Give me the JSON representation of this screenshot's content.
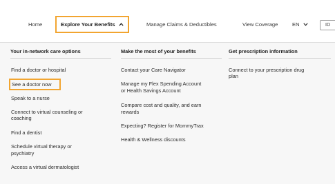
{
  "nav": {
    "home": "Home",
    "explore": "Explore Your Benefits",
    "explore_caret": "^",
    "claims": "Manage Claims & Deductibles",
    "coverage": "View Coverage",
    "lang": "EN",
    "lang_caret": "v",
    "id": "ID"
  },
  "columns": [
    {
      "heading": "Your in-network care options",
      "links": [
        "Find a doctor or hospital",
        "See a doctor now",
        "Speak to a nurse",
        "Connect to virtual counseling or",
        "coaching",
        "Find a dentist",
        "Schedule virtual therapy or",
        "psychiatry",
        "Access a virtual dermatologist"
      ]
    },
    {
      "heading": "Make the most of your benefits",
      "links": [
        "Contact your Care Navigator",
        "Manage my Flex Spending Account",
        "or Health Savings Account",
        "Compare cost and quality, and earn",
        "rewards",
        "Expecting? Register for MommyTrax",
        "Health & Wellness discounts"
      ]
    },
    {
      "heading": "Get prescription information",
      "links": [
        "Connect to your prescription drug",
        "plan"
      ]
    }
  ],
  "colors": {
    "highlight": "#f2a530"
  }
}
